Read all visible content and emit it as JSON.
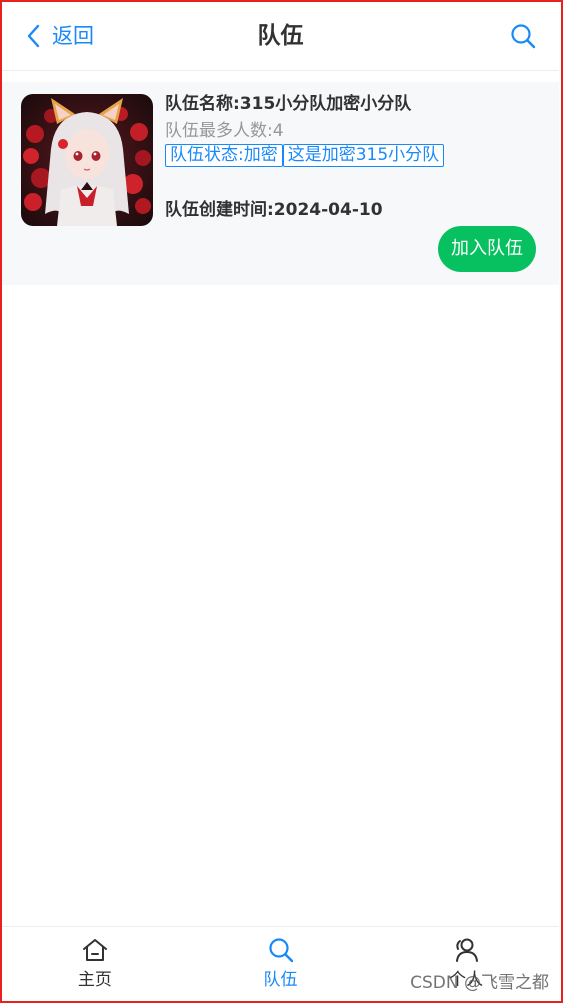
{
  "navbar": {
    "back_label": "返回",
    "title": "队伍",
    "accent_color": "#1989fa"
  },
  "team": {
    "name": "队伍名称:315小分队加密小分队",
    "max_members": "队伍最多人数:4",
    "status_tag": "队伍状态:加密",
    "description_tag": "这是加密315小分队",
    "created": "队伍创建时间:2024-04-10",
    "join_label": "加入队伍",
    "join_color": "#07c160",
    "avatar_icon": "anime-girl-avatar"
  },
  "tabbar": {
    "items": [
      {
        "label": "主页",
        "icon": "home-icon",
        "active": false
      },
      {
        "label": "队伍",
        "icon": "search-icon",
        "active": true
      },
      {
        "label": "个人",
        "icon": "user-icon",
        "active": false
      }
    ]
  },
  "watermark": "CSDN @飞雪之都"
}
